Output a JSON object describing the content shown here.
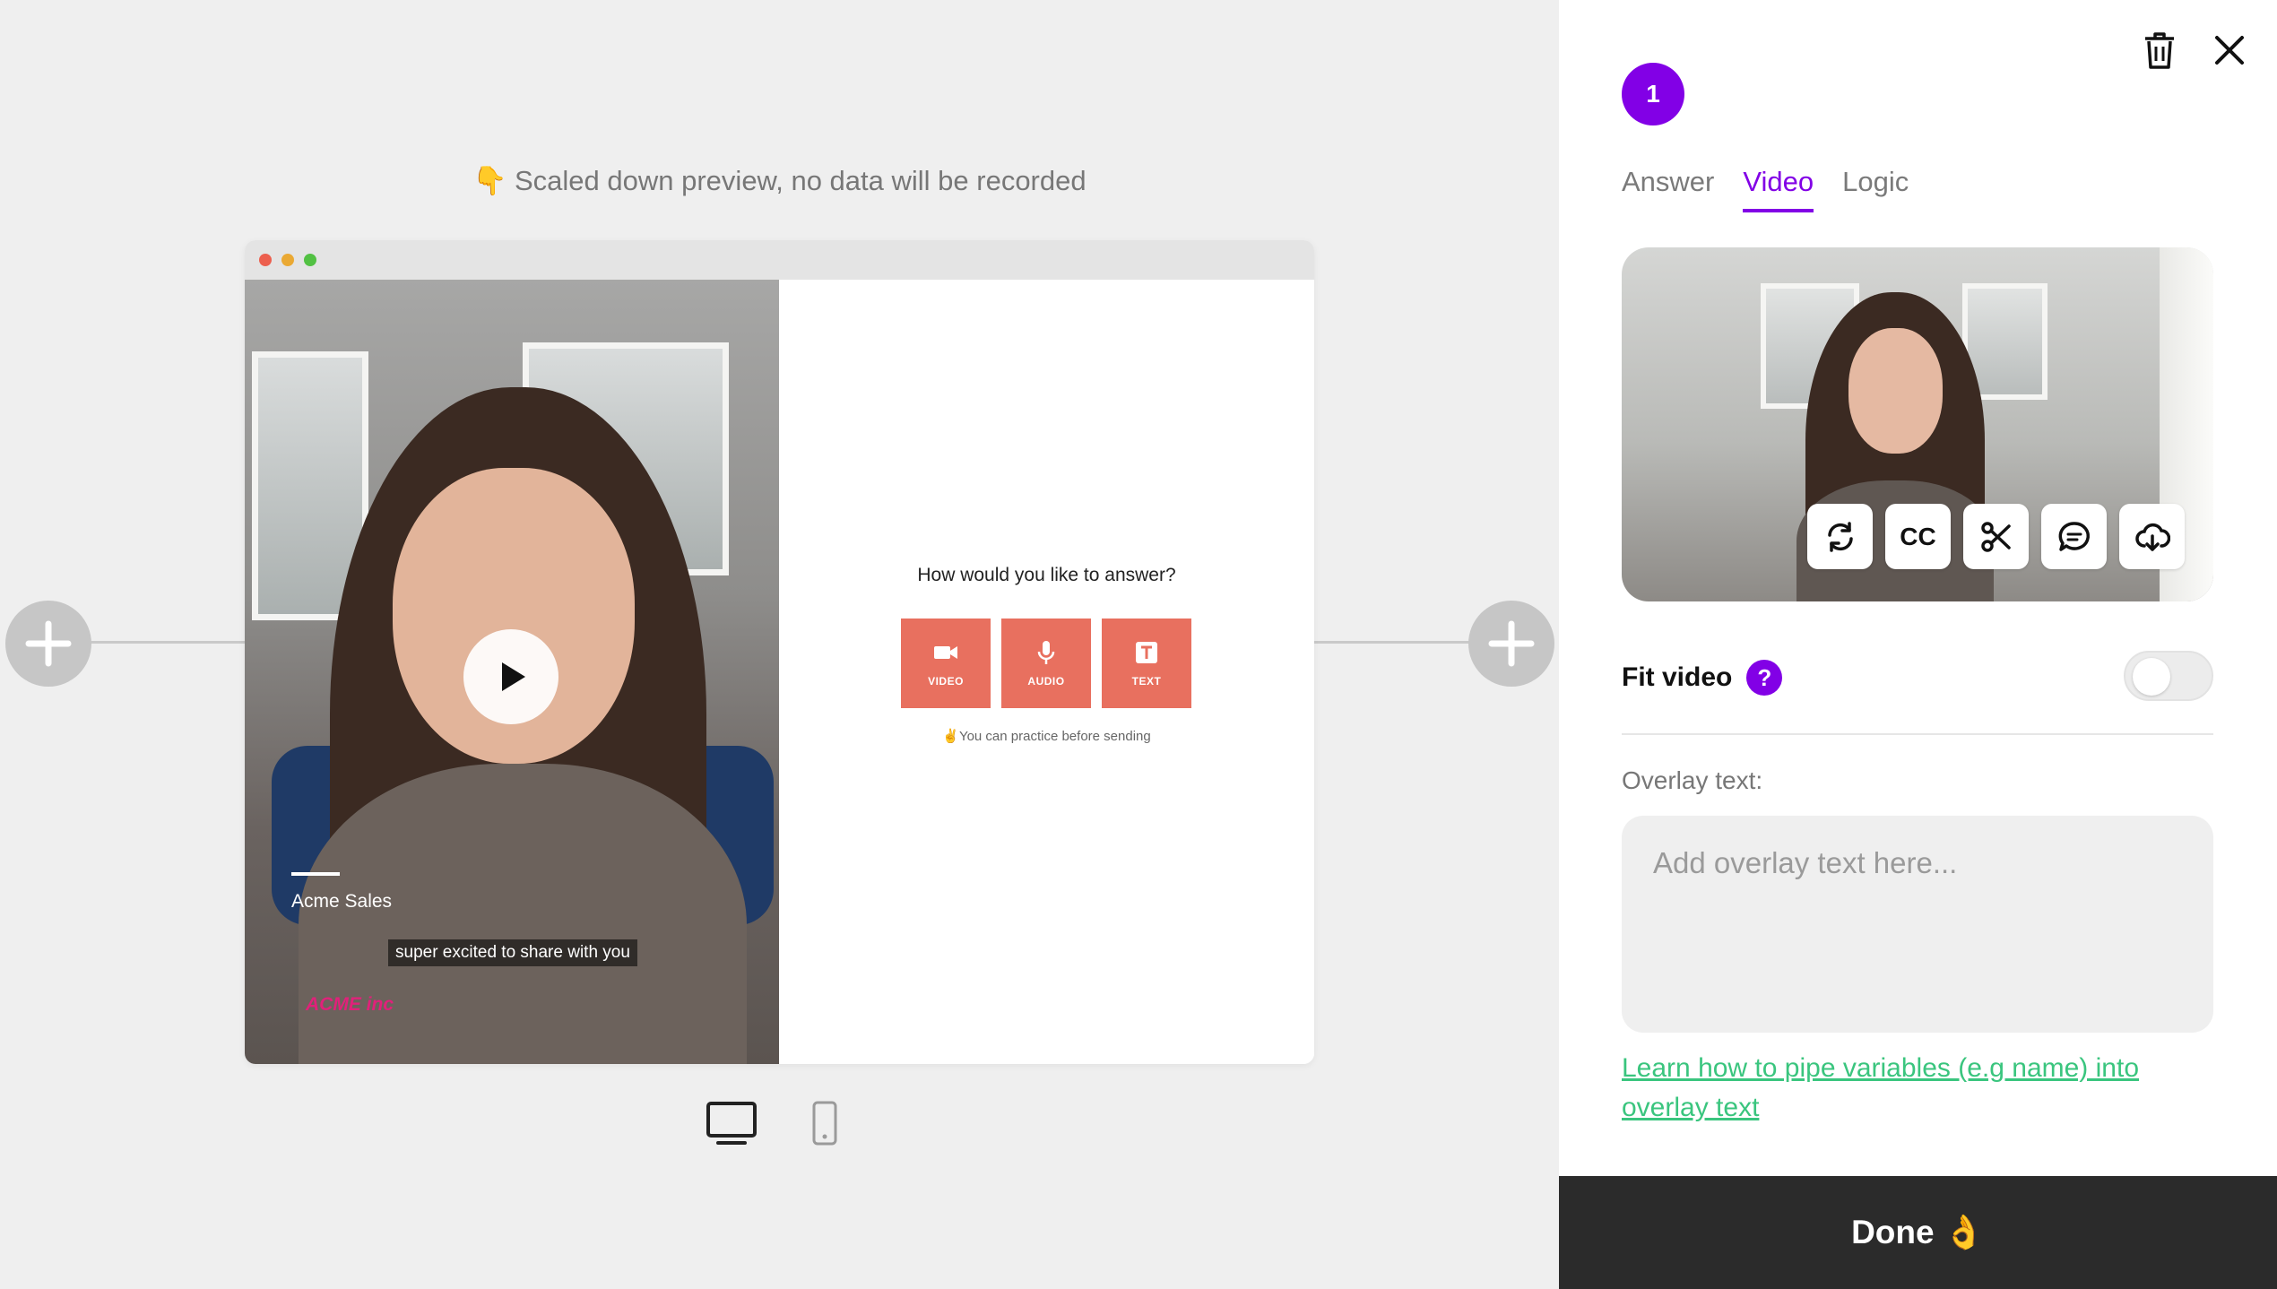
{
  "preview": {
    "note_emoji": "👇",
    "note": "Scaled down preview, no data will be recorded",
    "video": {
      "label": "Acme Sales",
      "caption": "super excited to share with you",
      "brand": "ACME inc"
    },
    "answer": {
      "question": "How would you like to answer?",
      "buttons": [
        {
          "label": "VIDEO",
          "icon": "video-camera-icon"
        },
        {
          "label": "AUDIO",
          "icon": "microphone-icon"
        },
        {
          "label": "TEXT",
          "icon": "text-icon"
        }
      ],
      "practice_note": "✌️You can practice before sending"
    },
    "devices": [
      "desktop-icon",
      "mobile-icon"
    ]
  },
  "panel": {
    "step_number": "1",
    "tabs": [
      {
        "label": "Answer",
        "active": false
      },
      {
        "label": "Video",
        "active": true
      },
      {
        "label": "Logic",
        "active": false
      }
    ],
    "video_tools": [
      {
        "name": "replace-video-icon"
      },
      {
        "name": "captions-button",
        "label": "CC"
      },
      {
        "name": "scissors-icon"
      },
      {
        "name": "comment-icon"
      },
      {
        "name": "cloud-download-icon"
      }
    ],
    "fit_video": {
      "label": "Fit video",
      "help": "?",
      "enabled": false
    },
    "overlay": {
      "label": "Overlay text:",
      "placeholder": "Add overlay text here...",
      "value": ""
    },
    "learn_link": "Learn how to pipe variables (e.g name) into overlay text",
    "done_label": "Done 👌"
  },
  "colors": {
    "accent": "#8200e6",
    "answer_button": "#e8705f",
    "link": "#3ac57e",
    "done_bg": "#2b2b2b"
  }
}
